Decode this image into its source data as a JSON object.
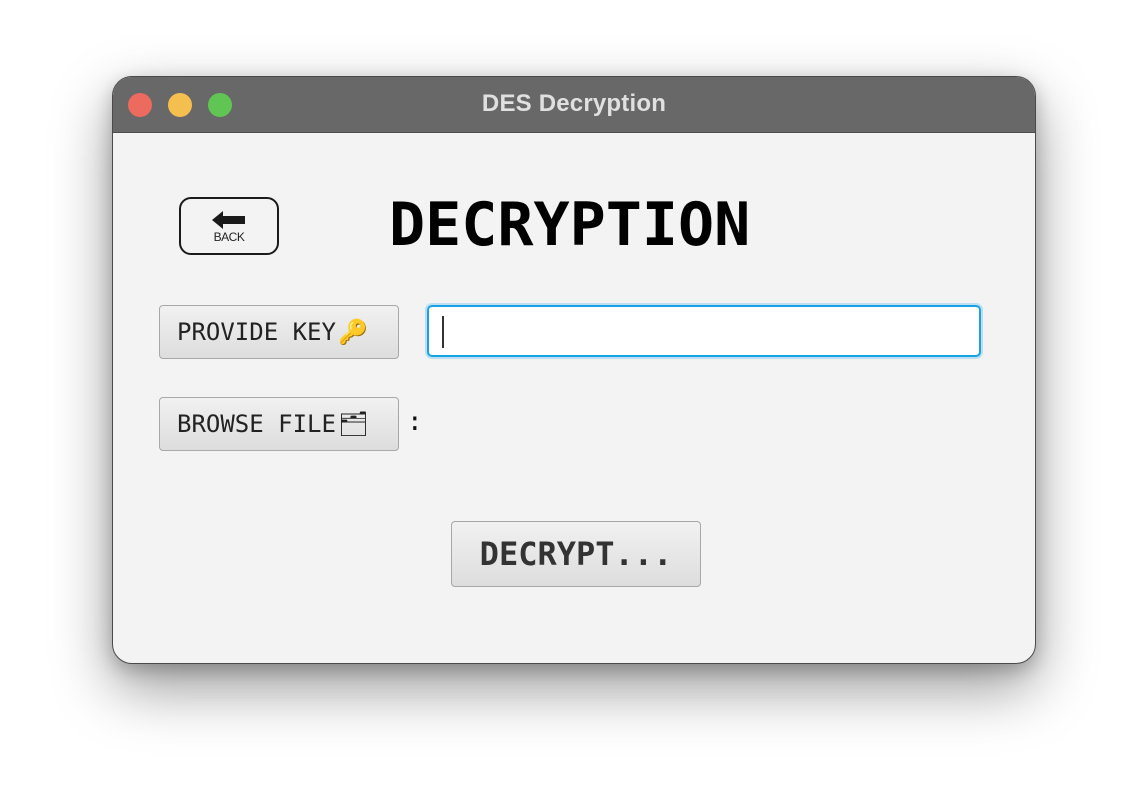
{
  "window": {
    "title": "DES Decryption"
  },
  "back_button": {
    "label": "BACK",
    "icon": "left-arrow-icon"
  },
  "heading": "DECRYPTION",
  "key_row": {
    "button_label": "PROVIDE KEY",
    "button_emoji": "🔑",
    "input_value": ""
  },
  "file_row": {
    "button_label": "BROWSE FILE",
    "button_emoji": "🗂",
    "selected_file_label": ":"
  },
  "decrypt_button": {
    "label": "DECRYPT..."
  },
  "colors": {
    "titlebar": "#686869",
    "window_bg": "#f3f3f3",
    "focus_ring": "#1aa2e6"
  }
}
